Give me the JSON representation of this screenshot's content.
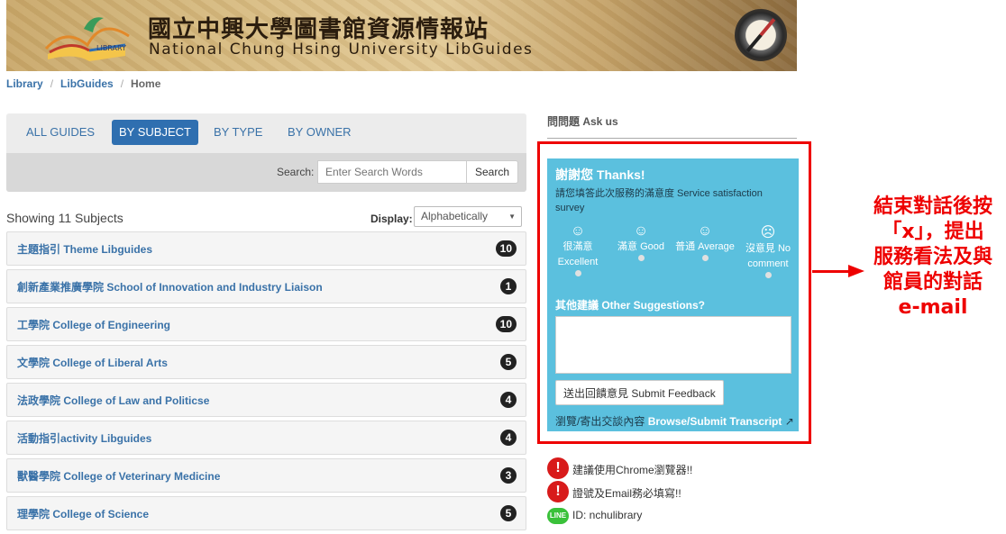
{
  "banner": {
    "title_zh": "國立中興大學圖書館資源情報站",
    "title_en": "National Chung Hsing University LibGuides",
    "logo_text": "LIBRARY"
  },
  "breadcrumb": {
    "items": [
      "Library",
      "LibGuides"
    ],
    "current": "Home"
  },
  "tabs": [
    "ALL GUIDES",
    "BY SUBJECT",
    "BY TYPE",
    "BY OWNER"
  ],
  "active_tab": "BY SUBJECT",
  "search": {
    "label": "Search:",
    "placeholder": "Enter Search Words",
    "button": "Search"
  },
  "listing": {
    "showing": "Showing 11 Subjects",
    "display_label": "Display:",
    "display_value": "Alphabetically"
  },
  "subjects": [
    {
      "name": "主題指引 Theme Libguides",
      "count": "10"
    },
    {
      "name": "創新產業推廣學院 School of Innovation and Industry Liaison",
      "count": "1"
    },
    {
      "name": "工學院 College of Engineering",
      "count": "10"
    },
    {
      "name": "文學院 College of Liberal Arts",
      "count": "5"
    },
    {
      "name": "法政學院 College of Law and Politicse",
      "count": "4"
    },
    {
      "name": "活動指引activity Libguides",
      "count": "4"
    },
    {
      "name": "獸醫學院 College of Veterinary Medicine",
      "count": "3"
    },
    {
      "name": "理學院 College of Science",
      "count": "5"
    }
  ],
  "ask": {
    "heading": "問問題 Ask us"
  },
  "survey": {
    "thanks": "謝謝您 Thanks!",
    "desc": "請您填答此次服務的滿意度 Service satisfaction survey",
    "ratings": [
      {
        "label": "很滿意 Excellent",
        "icon": "smile-icon"
      },
      {
        "label": "滿意 Good",
        "icon": "smile-icon"
      },
      {
        "label": "普通 Average",
        "icon": "neutral-face-icon"
      },
      {
        "label": "沒意見 No comment",
        "icon": "frown-icon"
      }
    ],
    "suggestions_label": "其他建議 Other Suggestions?",
    "submit_label": "送出回饋意見 Submit Feedback",
    "transcript_zh": "瀏覽/寄出交談內容",
    "transcript_en": "Browse/Submit Transcript"
  },
  "notes": [
    {
      "icon": "alert-icon",
      "text": "建議使用Chrome瀏覽器!!"
    },
    {
      "icon": "alert-icon",
      "text": "證號及Email務必填寫!!"
    },
    {
      "icon": "line-app-icon",
      "text": "ID: nchulibrary"
    }
  ],
  "annotation": {
    "text_lines": [
      "結束對話後按",
      "「x」，提出",
      "服務看法及與",
      "館員的對話",
      "e-mail"
    ],
    "color": "#e00000"
  }
}
